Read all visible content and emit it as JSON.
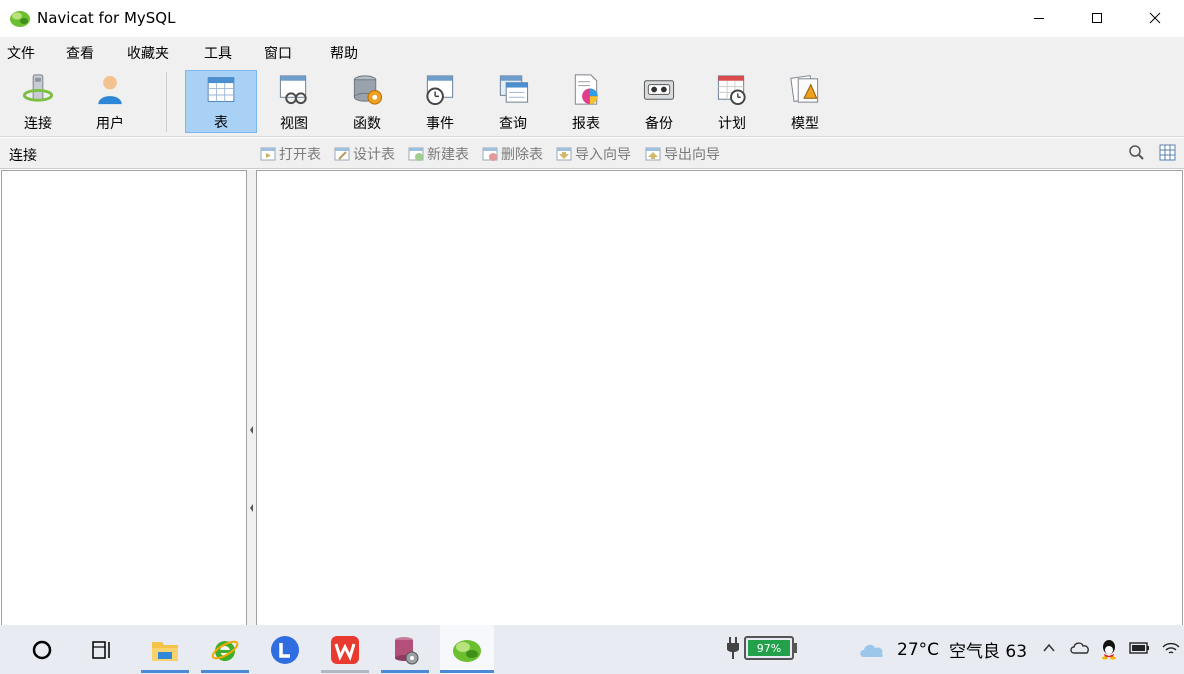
{
  "window": {
    "title": "Navicat for MySQL",
    "controls": [
      "minimize",
      "maximize",
      "close"
    ]
  },
  "menu": [
    "文件",
    "查看",
    "收藏夹",
    "工具",
    "窗口",
    "帮助"
  ],
  "toolbar": {
    "items": [
      {
        "label": "连接",
        "icon": "connection-icon",
        "active": false
      },
      {
        "label": "用户",
        "icon": "user-icon",
        "active": false
      },
      {
        "label": "表",
        "icon": "table-icon",
        "active": true
      },
      {
        "label": "视图",
        "icon": "view-icon",
        "active": false
      },
      {
        "label": "函数",
        "icon": "function-icon",
        "active": false
      },
      {
        "label": "事件",
        "icon": "event-icon",
        "active": false
      },
      {
        "label": "查询",
        "icon": "query-icon",
        "active": false
      },
      {
        "label": "报表",
        "icon": "report-icon",
        "active": false
      },
      {
        "label": "备份",
        "icon": "backup-icon",
        "active": false
      },
      {
        "label": "计划",
        "icon": "schedule-icon",
        "active": false
      },
      {
        "label": "模型",
        "icon": "model-icon",
        "active": false
      }
    ]
  },
  "subbar": {
    "connection_label": "连接",
    "actions": [
      "打开表",
      "设计表",
      "新建表",
      "删除表",
      "导入向导",
      "导出向导"
    ]
  },
  "taskbar": {
    "apps": [
      "cortana",
      "task-view",
      "file-explorer",
      "internet-explorer",
      "lark",
      "wps",
      "database-tool",
      "navicat"
    ],
    "battery_percent": "97%",
    "weather": {
      "temperature": "27°C",
      "air_quality": "空气良 63"
    }
  },
  "colors": {
    "active_tool_bg": "#a9d1f5",
    "chrome_bg": "#f0f0f0",
    "taskbar_bg": "#e8ecf2",
    "battery_fill": "#23a04a"
  }
}
